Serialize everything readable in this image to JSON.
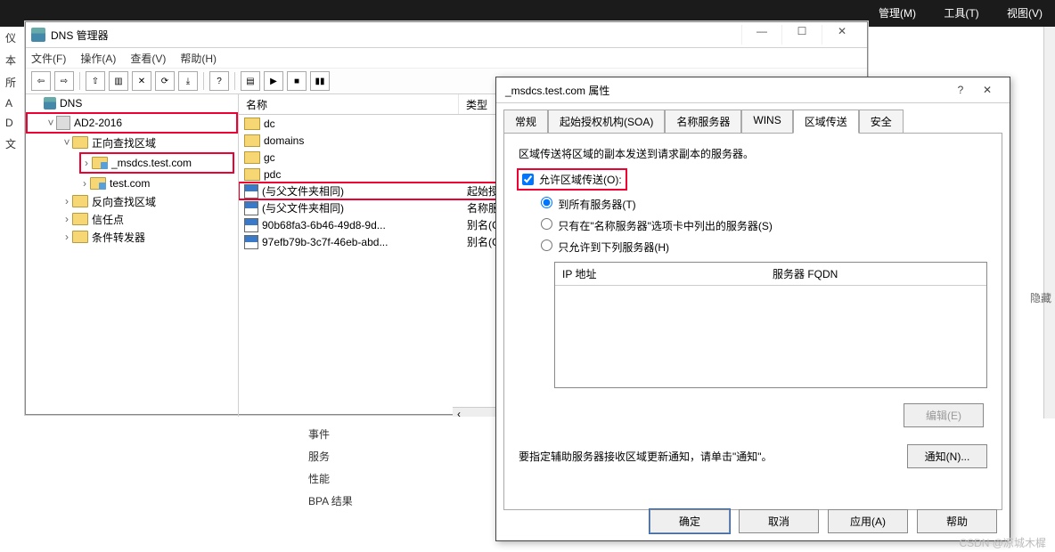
{
  "bg_menu": {
    "m1": "管理(M)",
    "m2": "工具(T)",
    "m3": "视图(V)"
  },
  "leftstrip": {
    "a": "仪",
    "b": "本",
    "c": "所",
    "d": "A",
    "e": "D",
    "f": "文"
  },
  "hidden_label": "隐藏",
  "dns": {
    "title": "DNS 管理器",
    "menu": {
      "file": "文件(F)",
      "action": "操作(A)",
      "view": "查看(V)",
      "help": "帮助(H)"
    },
    "root": "DNS",
    "server": "AD2-2016",
    "fwd": "正向查找区域",
    "zone1": "_msdcs.test.com",
    "zone2": "test.com",
    "rev": "反向查找区域",
    "trust": "信任点",
    "cond": "条件转发器",
    "col_name": "名称",
    "col_type": "类型",
    "rows": [
      {
        "name": "dc",
        "t": ""
      },
      {
        "name": "domains",
        "t": ""
      },
      {
        "name": "gc",
        "t": ""
      },
      {
        "name": "pdc",
        "t": ""
      },
      {
        "name": "(与父文件夹相同)",
        "t": "起始授"
      },
      {
        "name": "(与父文件夹相同)",
        "t": "名称服"
      },
      {
        "name": "90b68fa3-6b46-49d8-9d...",
        "t": "别名(C"
      },
      {
        "name": "97efb79b-3c7f-46eb-abd...",
        "t": "别名(C"
      }
    ]
  },
  "side": {
    "events": "事件",
    "services": "服务",
    "perf": "性能",
    "bpa": "BPA 结果"
  },
  "props": {
    "title": "_msdcs.test.com 属性",
    "tabs": {
      "general": "常规",
      "soa": "起始授权机构(SOA)",
      "ns": "名称服务器",
      "wins": "WINS",
      "zt": "区域传送",
      "sec": "安全"
    },
    "desc": "区域传送将区域的副本发送到请求副本的服务器。",
    "allow": "允许区域传送(O):",
    "r1": "到所有服务器(T)",
    "r2": "只有在\"名称服务器\"选项卡中列出的服务器(S)",
    "r3": "只允许到下列服务器(H)",
    "ipcol": "IP 地址",
    "fqdncol": "服务器 FQDN",
    "edit": "编辑(E)",
    "notify_text": "要指定辅助服务器接收区域更新通知，请单击\"通知\"。",
    "notify_btn": "通知(N)...",
    "ok": "确定",
    "cancel": "取消",
    "apply": "应用(A)",
    "help": "帮助"
  },
  "watermark": "CSDN @凉城木樨"
}
